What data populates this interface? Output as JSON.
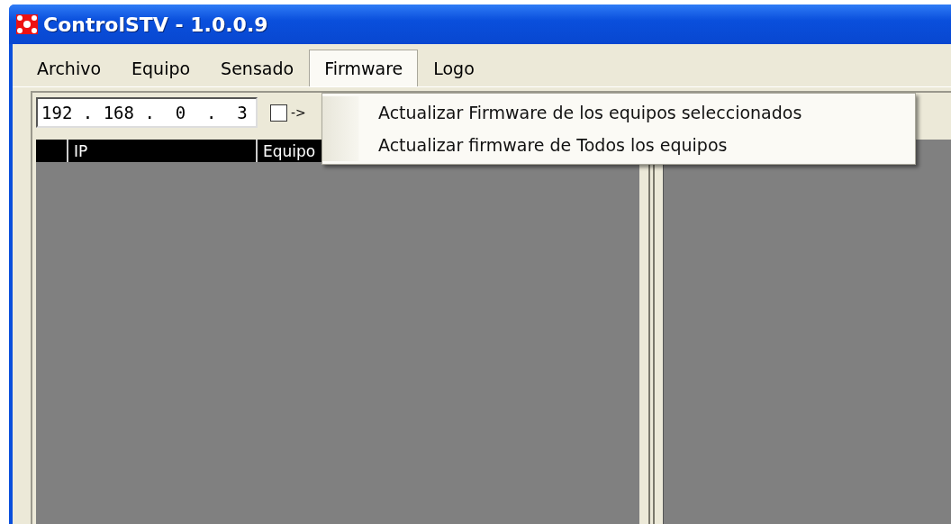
{
  "window": {
    "title": "ControlSTV - 1.0.0.9"
  },
  "menu": [
    {
      "label": "Archivo",
      "selected": false
    },
    {
      "label": "Equipo",
      "selected": false
    },
    {
      "label": "Sensado",
      "selected": false
    },
    {
      "label": "Firmware",
      "selected": true
    },
    {
      "label": "Logo",
      "selected": false
    }
  ],
  "toolbar": {
    "ip_field": {
      "value": "192 . 168 .  0  .  3"
    },
    "checkbox": {
      "checked": false
    },
    "arrow_label": "->"
  },
  "table": {
    "columns": [
      {
        "label": "IP"
      },
      {
        "label": "Equipo"
      }
    ]
  },
  "dropdown": {
    "items": [
      {
        "label": "Actualizar Firmware de los equipos seleccionados"
      },
      {
        "label": "Actualizar firmware de Todos los equipos"
      }
    ]
  }
}
